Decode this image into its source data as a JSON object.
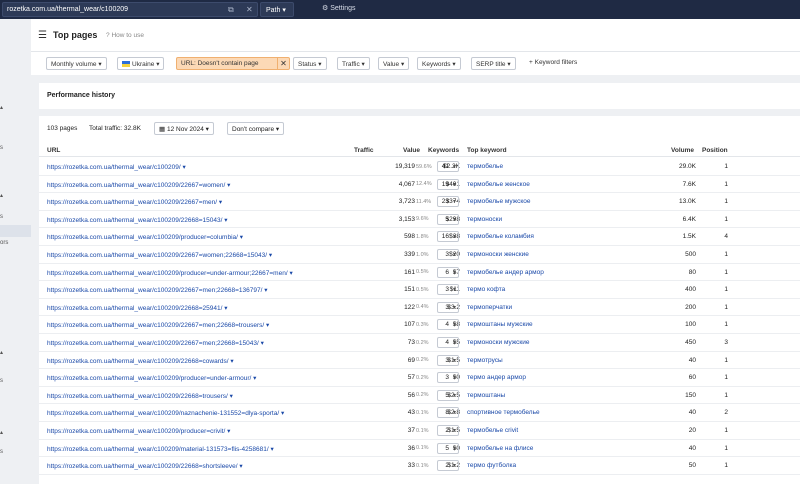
{
  "topbar": {
    "url": "rozetka.com.ua/thermal_wear/c100209",
    "mode": "Path",
    "settings": "Settings"
  },
  "leftnav": [
    "s",
    "s",
    "ors",
    "s",
    "s"
  ],
  "header": {
    "title": "Top pages",
    "help": "How to use"
  },
  "filters": {
    "monthly_volume": "Monthly volume",
    "country": "Ukraine",
    "url_filter": "URL: Doesn't contain page",
    "status": "Status",
    "traffic": "Traffic",
    "value": "Value",
    "keywords": "Keywords",
    "serp_title": "SERP title",
    "keyword_filters": "Keyword filters"
  },
  "performance": {
    "title": "Performance history"
  },
  "summary": {
    "pages": "103 pages",
    "total_traffic": "Total traffic: 32.8K",
    "date": "12 Nov 2024",
    "compare": "Don't compare"
  },
  "columns": {
    "url": "URL",
    "traffic": "Traffic",
    "value": "Value",
    "keywords": "Keywords",
    "top_keyword": "Top keyword",
    "volume": "Volume",
    "position": "Position"
  },
  "rows": [
    {
      "url": "https://rozetka.com.ua/thermal_wear/c100209/",
      "traffic": "19,319",
      "pct": "59.6%",
      "value": "$2.2K",
      "kw": "41",
      "top": "термобелье",
      "vol": "29.0K",
      "pos": "1"
    },
    {
      "url": "https://rozetka.com.ua/thermal_wear/c100209/22667=women/",
      "traffic": "4,067",
      "pct": "12.4%",
      "value": "$401",
      "kw": "19",
      "top": "термобелье женское",
      "vol": "7.6K",
      "pos": "1"
    },
    {
      "url": "https://rozetka.com.ua/thermal_wear/c100209/22667=men/",
      "traffic": "3,723",
      "pct": "11.4%",
      "value": "$374",
      "kw": "23",
      "top": "термобелье мужское",
      "vol": "13.0K",
      "pos": "1"
    },
    {
      "url": "https://rozetka.com.ua/thermal_wear/c100209/22668=15043/",
      "traffic": "3,153",
      "pct": "9.6%",
      "value": "$298",
      "kw": "5",
      "top": "термоноски",
      "vol": "6.4K",
      "pos": "1"
    },
    {
      "url": "https://rozetka.com.ua/thermal_wear/c100209/producer=columbia/",
      "traffic": "598",
      "pct": "1.8%",
      "value": "$38",
      "kw": "16",
      "top": "термобелье коламбия",
      "vol": "1.5K",
      "pos": "4"
    },
    {
      "url": "https://rozetka.com.ua/thermal_wear/c100209/22667=women;22668=15043/",
      "traffic": "339",
      "pct": "1.0%",
      "value": "$20",
      "kw": "3",
      "top": "термоноски женские",
      "vol": "500",
      "pos": "1"
    },
    {
      "url": "https://rozetka.com.ua/thermal_wear/c100209/producer=under-armour;22667=men/",
      "traffic": "161",
      "pct": "0.5%",
      "value": "$7",
      "kw": "6",
      "top": "термобелье андер армор",
      "vol": "80",
      "pos": "1"
    },
    {
      "url": "https://rozetka.com.ua/thermal_wear/c100209/22667=men;22668=136797/",
      "traffic": "151",
      "pct": "0.5%",
      "value": "$11",
      "kw": "3",
      "top": "термо кофта",
      "vol": "400",
      "pos": "1"
    },
    {
      "url": "https://rozetka.com.ua/thermal_wear/c100209/22668=25941/",
      "traffic": "122",
      "pct": "0.4%",
      "value": "$3.2",
      "kw": "3",
      "top": "термоперчатки",
      "vol": "200",
      "pos": "1"
    },
    {
      "url": "https://rozetka.com.ua/thermal_wear/c100209/22667=men;22668=trousers/",
      "traffic": "107",
      "pct": "0.3%",
      "value": "$8",
      "kw": "4",
      "top": "термоштаны мужские",
      "vol": "100",
      "pos": "1"
    },
    {
      "url": "https://rozetka.com.ua/thermal_wear/c100209/22667=men;22668=15043/",
      "traffic": "73",
      "pct": "0.2%",
      "value": "$5",
      "kw": "4",
      "top": "термоноски мужские",
      "vol": "450",
      "pos": "3"
    },
    {
      "url": "https://rozetka.com.ua/thermal_wear/c100209/22668=cowards/",
      "traffic": "69",
      "pct": "0.2%",
      "value": "$1.5",
      "kw": "3",
      "top": "термотрусы",
      "vol": "40",
      "pos": "1"
    },
    {
      "url": "https://rozetka.com.ua/thermal_wear/c100209/producer=under-armour/",
      "traffic": "57",
      "pct": "0.2%",
      "value": "$0",
      "kw": "3",
      "top": "термо андер армор",
      "vol": "60",
      "pos": "1"
    },
    {
      "url": "https://rozetka.com.ua/thermal_wear/c100209/22668=trousers/",
      "traffic": "56",
      "pct": "0.2%",
      "value": "$2.5",
      "kw": "5",
      "top": "термоштаны",
      "vol": "150",
      "pos": "1"
    },
    {
      "url": "https://rozetka.com.ua/thermal_wear/c100209/naznachenie-131552=dlya-sporta/",
      "traffic": "43",
      "pct": "0.1%",
      "value": "$2.8",
      "kw": "8",
      "top": "спортивное термобелье",
      "vol": "40",
      "pos": "2"
    },
    {
      "url": "https://rozetka.com.ua/thermal_wear/c100209/producer=crivit/",
      "traffic": "37",
      "pct": "0.1%",
      "value": "$1.5",
      "kw": "2",
      "top": "термобелье crivit",
      "vol": "20",
      "pos": "1"
    },
    {
      "url": "https://rozetka.com.ua/thermal_wear/c100209/material-131573=flis-4258681/",
      "traffic": "36",
      "pct": "0.1%",
      "value": "$0",
      "kw": "5",
      "top": "термобелье на флисе",
      "vol": "40",
      "pos": "1"
    },
    {
      "url": "https://rozetka.com.ua/thermal_wear/c100209/22668=shortsleeve/",
      "traffic": "33",
      "pct": "0.1%",
      "value": "$1.2",
      "kw": "2",
      "top": "термо футболка",
      "vol": "50",
      "pos": "1"
    }
  ]
}
